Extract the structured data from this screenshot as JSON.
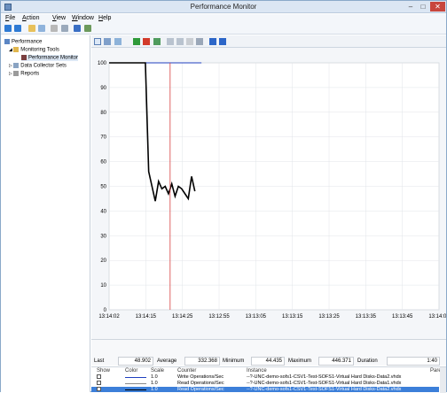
{
  "window": {
    "title": "Performance Monitor"
  },
  "menu": [
    {
      "accel": "F",
      "rest": "ile"
    },
    {
      "accel": "A",
      "rest": "ction"
    },
    {
      "accel": "V",
      "rest": "iew"
    },
    {
      "accel": "W",
      "rest": "indow"
    },
    {
      "accel": "H",
      "rest": "elp"
    }
  ],
  "tree": {
    "performance": "Performance",
    "monitoring_tools": "Monitoring Tools",
    "performance_monitor": "Performance Monitor",
    "data_collector_sets": "Data Collector Sets",
    "reports": "Reports"
  },
  "chart_data": {
    "type": "line",
    "ylim": [
      0,
      100
    ],
    "yticks": [
      "100",
      "90",
      "80",
      "70",
      "60",
      "50",
      "40",
      "30",
      "20",
      "10",
      "0"
    ],
    "xticks": [
      "13:14:02",
      "13:14:15",
      "13:14:25",
      "13:12:55",
      "13:13:05",
      "13:13:15",
      "13:13:25",
      "13:13:35",
      "13:13:45",
      "13:14:01"
    ],
    "x": [
      0,
      11,
      12,
      13,
      14,
      15,
      16,
      17,
      18,
      19,
      20,
      21,
      22,
      23,
      24,
      25,
      26,
      27,
      28
    ],
    "series": [
      {
        "color": "#000000",
        "values": [
          100,
          100,
          56,
          50,
          44,
          52,
          49,
          50,
          47,
          51,
          46,
          50,
          49,
          47,
          45,
          54,
          48,
          null,
          null
        ]
      },
      {
        "color": "#1f3fbf",
        "values": [
          100,
          100,
          100,
          100,
          100,
          100,
          100,
          100,
          100,
          100,
          100,
          100,
          100,
          100,
          100,
          100,
          100,
          100,
          100
        ]
      }
    ],
    "current_marker_x": 18.5,
    "x_count": 100
  },
  "stats": {
    "last_label": "Last",
    "last": "48.902",
    "average_label": "Average",
    "average": "332.368",
    "minimum_label": "Minimum",
    "minimum": "44.435",
    "maximum_label": "Maximum",
    "maximum": "446.371",
    "duration_label": "Duration",
    "duration": "1:40"
  },
  "legend": {
    "headers": {
      "show": "Show",
      "color": "Color",
      "scale": "Scale",
      "counter": "Counter",
      "instance": "Instance",
      "parent": "Pare"
    },
    "rows": [
      {
        "scale": "1.0",
        "counter": "Write Operations/Sec",
        "instance": "--?-UNC-demo-sofs1-CSV1-Test-SOFS1-Virtual Hard Disks-Data2.vhdx",
        "color": "#1f3fbf",
        "selected": false
      },
      {
        "scale": "1.0",
        "counter": "Read Operations/Sec",
        "instance": "--?-UNC-demo-sofs1-CSV1-Test-SOFS1-Virtual Hard Disks-Data1.vhdx",
        "color": "#8a8a8a",
        "selected": false
      },
      {
        "scale": "1.0",
        "counter": "Read Operations/Sec",
        "instance": "--?-UNC-demo-sofs1-CSV1-Test-SOFS1-Virtual Hard Disks-Data2.vhdx",
        "color": "#000000",
        "selected": true
      }
    ]
  },
  "window_buttons": {
    "minimize": "–",
    "maximize": "□",
    "close": "✕"
  }
}
